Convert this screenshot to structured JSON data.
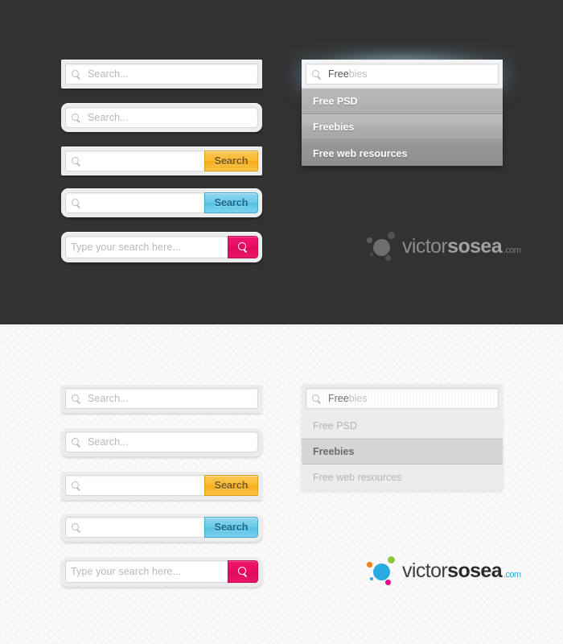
{
  "theme": {
    "dark_bg": "#333232",
    "light_bg": "#fafafa",
    "accent_yellow": "#f9b82f",
    "accent_blue": "#68c9e8",
    "accent_pink": "#e40c63",
    "logo_cyan": "#29abe2",
    "logo_orange": "#f07d1a",
    "logo_green": "#8cc63f",
    "logo_magenta": "#ec008c",
    "logo_gray": "#7d7c7c"
  },
  "dark_section": {
    "boxes": [
      {
        "name": "search-box-plain-square",
        "placeholder": "Search...",
        "icon": "search-icon"
      },
      {
        "name": "search-box-plain-rounded",
        "placeholder": "Search...",
        "icon": "search-icon"
      },
      {
        "name": "search-box-yellow-button",
        "placeholder": "",
        "icon": "search-icon",
        "button_label": "Search"
      },
      {
        "name": "search-box-blue-button",
        "placeholder": "",
        "icon": "search-icon",
        "button_label": "Search"
      },
      {
        "name": "search-box-pink-icon-button",
        "placeholder": "Type your search here...",
        "button_icon": "search-icon"
      }
    ],
    "autocomplete": {
      "icon": "search-icon",
      "typed_text": "Free",
      "suggested_text": "bies",
      "items": [
        {
          "label": "Free PSD",
          "selected": false
        },
        {
          "label": "Freebies",
          "selected": true
        },
        {
          "label": "Free web resources",
          "selected": false
        }
      ]
    },
    "logo": {
      "part1": "victor",
      "part2": "sosea",
      "part3": ".com"
    }
  },
  "light_section": {
    "boxes": [
      {
        "name": "search-box-plain-square",
        "placeholder": "Search...",
        "icon": "search-icon"
      },
      {
        "name": "search-box-plain-rounded",
        "placeholder": "Search...",
        "icon": "search-icon"
      },
      {
        "name": "search-box-yellow-button",
        "placeholder": "",
        "icon": "search-icon",
        "button_label": "Search"
      },
      {
        "name": "search-box-blue-button",
        "placeholder": "",
        "icon": "search-icon",
        "button_label": "Search"
      },
      {
        "name": "search-box-pink-icon-button",
        "placeholder": "Type your search here...",
        "button_icon": "search-icon"
      }
    ],
    "autocomplete": {
      "icon": "search-icon",
      "typed_text": "Free",
      "suggested_text": "bies",
      "items": [
        {
          "label": "Free PSD",
          "selected": false
        },
        {
          "label": "Freebies",
          "selected": true
        },
        {
          "label": "Free web resources",
          "selected": false
        }
      ]
    },
    "logo": {
      "part1": "victor",
      "part2": "sosea",
      "part3": ".com"
    }
  }
}
